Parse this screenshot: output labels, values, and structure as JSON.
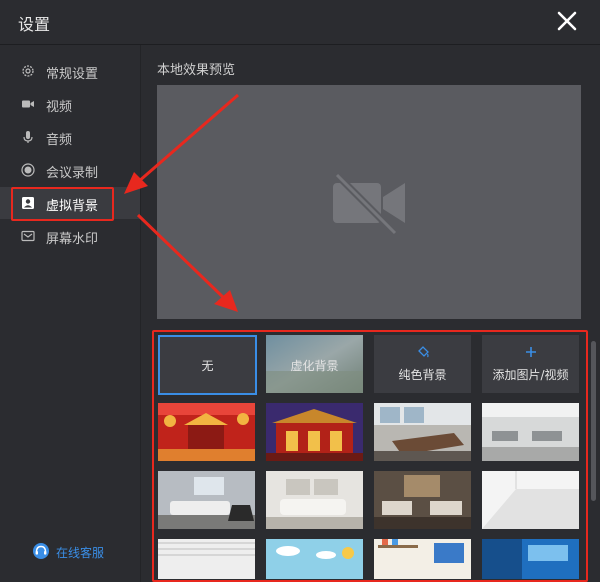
{
  "window": {
    "title": "设置"
  },
  "sidebar": {
    "items": [
      {
        "label": "常规设置",
        "icon": "gear-icon"
      },
      {
        "label": "视频",
        "icon": "video-camera-icon"
      },
      {
        "label": "音频",
        "icon": "microphone-icon"
      },
      {
        "label": "会议录制",
        "icon": "record-icon"
      },
      {
        "label": "虚拟背景",
        "icon": "person-card-icon",
        "active": true
      },
      {
        "label": "屏幕水印",
        "icon": "watermark-icon"
      }
    ],
    "service_label": "在线客服"
  },
  "main": {
    "preview_label": "本地效果预览",
    "preview_icon": "camera-off-icon",
    "options": [
      {
        "label": "无",
        "selected": true
      },
      {
        "label": "虚化背景"
      },
      {
        "label": "纯色背景",
        "icon": "paint-bucket-icon"
      },
      {
        "label": "添加图片/视频",
        "icon": "plus-icon"
      }
    ],
    "backgrounds": [
      "spring-festival-red-lanterns",
      "spring-festival-gate",
      "meeting-room",
      "open-office",
      "living-room",
      "white-sofa-room",
      "dark-living-room",
      "blank-white-room",
      "white-ceiling",
      "cartoon-sky",
      "kids-shelf",
      "blue-office"
    ]
  },
  "colors": {
    "accent": "#3a8ee6",
    "annotation": "#e8281e",
    "panel": "#2b2c30",
    "preview": "#5a5b60"
  }
}
